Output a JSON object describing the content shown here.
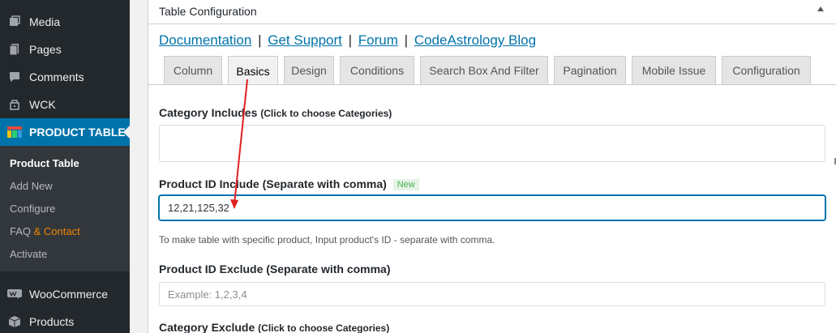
{
  "sidebar": {
    "items": [
      {
        "label": "Media",
        "icon": "media-icon"
      },
      {
        "label": "Pages",
        "icon": "pages-icon"
      },
      {
        "label": "Comments",
        "icon": "comments-icon"
      },
      {
        "label": "WCK",
        "icon": "wck-icon"
      },
      {
        "label": "PRODUCT TABLE",
        "icon": "product-table-icon"
      },
      {
        "label": "WooCommerce",
        "icon": "woocommerce-icon"
      },
      {
        "label": "Products",
        "icon": "products-icon"
      }
    ],
    "submenu": {
      "product_table": "Product Table",
      "add_new": "Add New",
      "configure": "Configure",
      "faq_prefix": "FAQ",
      "faq_suffix": "& Contact",
      "activate": "Activate"
    },
    "colors": {
      "active": "#0073aa",
      "faq_accent": "#f18500"
    }
  },
  "panel": {
    "title": "Table Configuration",
    "links": {
      "documentation": "Documentation",
      "support": "Get Support",
      "forum": "Forum",
      "blog": "CodeAstrology Blog",
      "separator": "|"
    },
    "tabs": [
      "Column",
      "Basics",
      "Design",
      "Conditions",
      "Search Box And Filter",
      "Pagination",
      "Mobile Issue",
      "Configuration"
    ],
    "active_tab": "Basics",
    "fields": {
      "category_includes": {
        "label": "Category Includes",
        "hint": "(Click to choose Categories)",
        "value": ""
      },
      "product_id_include": {
        "label": "Product ID Include (Separate with comma)",
        "badge": "New",
        "value": "12,21,125,32",
        "help": "To make table with specific product, Input product's ID - separate with comma."
      },
      "product_id_exclude": {
        "label": "Product ID Exclude (Separate with comma)",
        "placeholder": "Example: 1,2,3,4",
        "value": ""
      },
      "category_exclude": {
        "label": "Category Exclude",
        "hint": "(Click to choose Categories)"
      }
    }
  }
}
